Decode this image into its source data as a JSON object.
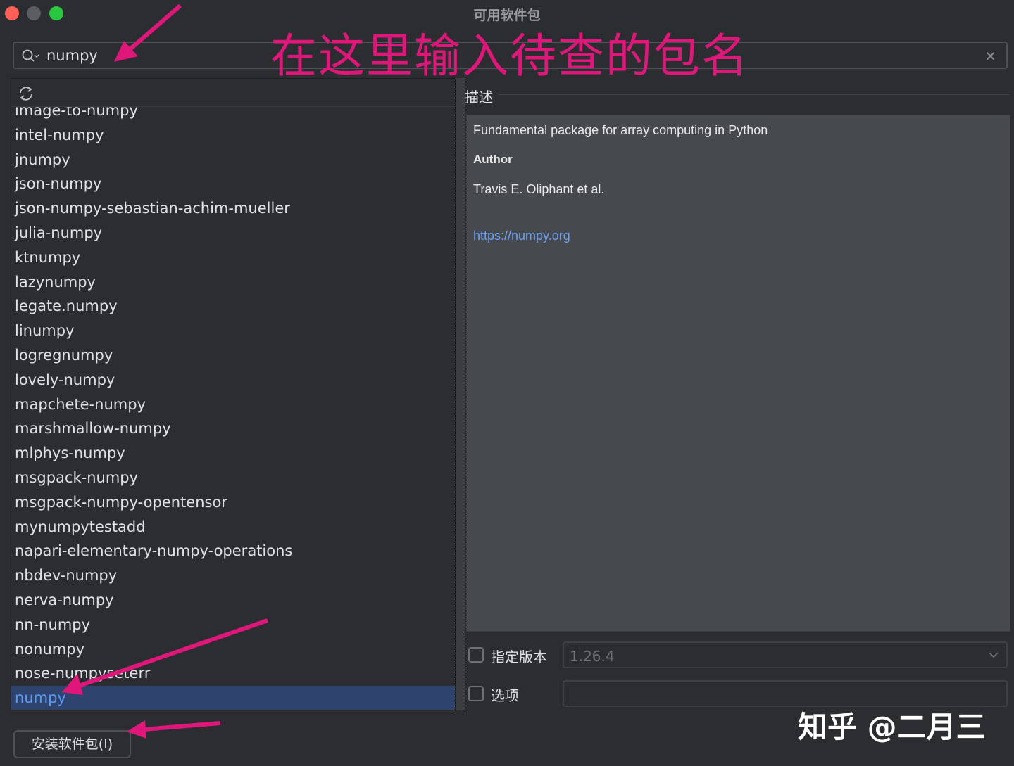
{
  "window": {
    "title": "可用软件包"
  },
  "search": {
    "value": "numpy"
  },
  "annotation": {
    "text": "在这里输入待查的包名"
  },
  "packages": {
    "items": [
      "image-to-numpy",
      "intel-numpy",
      "jnumpy",
      "json-numpy",
      "json-numpy-sebastian-achim-mueller",
      "julia-numpy",
      "ktnumpy",
      "lazynumpy",
      "legate.numpy",
      "linumpy",
      "logregnumpy",
      "lovely-numpy",
      "mapchete-numpy",
      "marshmallow-numpy",
      "mlphys-numpy",
      "msgpack-numpy",
      "msgpack-numpy-opentensor",
      "mynumpytestadd",
      "napari-elementary-numpy-operations",
      "nbdev-numpy",
      "nerva-numpy",
      "nn-numpy",
      "nonumpy",
      "nose-numpyseterr",
      "numpy"
    ],
    "selected": "numpy"
  },
  "description": {
    "label": "描述",
    "summary": "Fundamental package for array computing in Python",
    "author_heading": "Author",
    "author": "Travis E. Oliphant et al.",
    "link": "https://numpy.org"
  },
  "options": {
    "specify_version_label": "指定版本",
    "version_value": "1.26.4",
    "options_label": "选项",
    "options_value": ""
  },
  "install_button": {
    "label": "安装软件包(I)"
  },
  "watermark": {
    "text": "知乎 @二月三"
  },
  "colors": {
    "annotation": "#e0177a",
    "selection_bg": "#2e436e",
    "selection_text": "#5b9bf8",
    "link": "#6a9ff5"
  }
}
